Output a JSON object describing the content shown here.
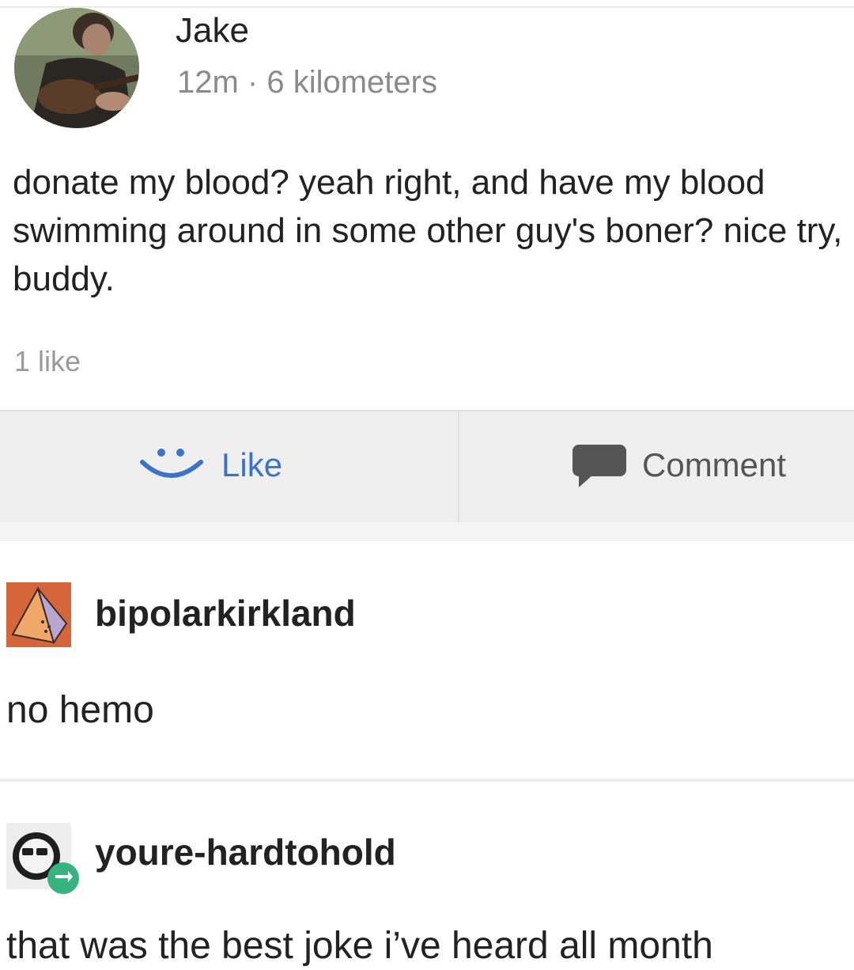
{
  "post": {
    "author": "Jake",
    "meta": "12m · 6 kilometers",
    "body": "donate my blood? yeah right, and have my blood swimming around in some other guy's boner? nice try, buddy.",
    "like_count": "1 like",
    "actions": {
      "like_label": "Like",
      "comment_label": "Comment"
    },
    "colors": {
      "like_accent": "#3b74c6",
      "action_bar_bg": "#efefef"
    }
  },
  "comments": [
    {
      "username": "bipolarkirkland",
      "text": "no hemo",
      "avatar_icon": "pyramid-avatar-icon",
      "avatar_color": "#d4663a"
    },
    {
      "username": "youre-hardtohold",
      "text": "that was the best joke i’ve heard all month",
      "avatar_icon": "sunglasses-avatar-icon",
      "badge_icon": "reblog-icon",
      "badge_color": "#36b37e"
    }
  ]
}
